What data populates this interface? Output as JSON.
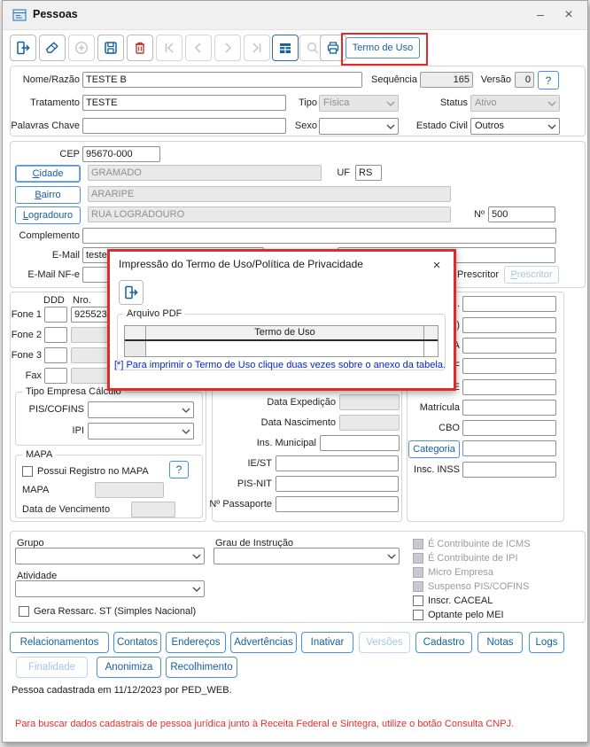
{
  "window": {
    "title": "Pessoas",
    "minimize_glyph": "–",
    "close_glyph": "×"
  },
  "toolbar": {
    "termo_de_uso_label": "Termo de Uso",
    "icons": [
      "exit-icon",
      "clear-icon",
      "add-icon",
      "save-icon",
      "delete-icon",
      "first-record-icon",
      "previous-record-icon",
      "next-record-icon",
      "last-record-icon",
      "browse-grid-icon",
      "search-icon",
      "print-icon"
    ]
  },
  "identity": {
    "nome_label": "Nome/Razão",
    "nome_value": "TESTE B",
    "sequencia_label": "Sequência",
    "sequencia_value": "165",
    "versao_label": "Versão",
    "versao_value": "0",
    "help_label": "?",
    "tratamento_label": "Tratamento",
    "tratamento_value": "TESTE",
    "tipo_label": "Tipo",
    "tipo_value": "Física",
    "status_label": "Status",
    "status_value": "Ativo",
    "palavras_chave_label": "Palavras Chave",
    "sexo_label": "Sexo",
    "sexo_value": "",
    "estado_civil_label": "Estado Civil",
    "estado_civil_value": "Outros"
  },
  "address": {
    "cep_label": "CEP",
    "cep_value": "95670-000",
    "cidade_button_label": "Cidade",
    "cidade_value": "GRAMADO",
    "uf_label": "UF",
    "uf_value": "RS",
    "bairro_button_label": "Bairro",
    "bairro_value": "ARARIPE",
    "logradouro_button_label": "Logradouro",
    "logradouro_value": "RUA LOGRADOURO",
    "numero_label": "Nº",
    "numero_value": "500",
    "complemento_label": "Complemento",
    "email_label": "E-Mail",
    "email_value": "teste",
    "email_nfe_label": "E-Mail NF-e"
  },
  "professional": {
    "prescritor_label": "Prescritor",
    "prescritor_button_label": "Prescritor",
    "hidden_label_fragments": [
      ".",
      ")",
      "A",
      "F",
      "E"
    ],
    "matricula_label": "Matrícula",
    "cbo_label": "CBO",
    "categoria_button_label": "Categoria",
    "insc_inss_label": "Insc. INSS"
  },
  "phones": {
    "ddd_header": "DDD",
    "nro_header": "Nro.",
    "fone1_label": "Fone 1",
    "fone1_value": "925523",
    "fone2_label": "Fone 2",
    "fone3_label": "Fone 3",
    "fax_label": "Fax"
  },
  "tax_group": {
    "title": "Tipo Empresa Cálculo",
    "pis_cofins_label": "PIS/COFINS",
    "ipi_label": "IPI"
  },
  "mapa_group": {
    "title": "MAPA",
    "possui_registro_label": "Possui Registro no MAPA",
    "help_label": "?",
    "mapa_label": "MAPA",
    "data_vencimento_label": "Data de Vencimento"
  },
  "documents": {
    "data_expedicao_label": "Data Expedição",
    "data_nascimento_label": "Data Nascimento",
    "ins_municipal_label": "Ins. Municipal",
    "ie_st_label": "IE/ST",
    "pis_nit_label": "PIS-NIT",
    "passaporte_label": "Nº Passaporte"
  },
  "classification": {
    "grupo_label": "Grupo",
    "grau_instrucao_label": "Grau de Instrução",
    "atividade_label": "Atividade",
    "gera_ressarc_label": "Gera Ressarc. ST (Simples Nacional)",
    "flags": [
      {
        "label": "É Contribuinte de ICMS",
        "enabled": false
      },
      {
        "label": "É Contribuinte de IPI",
        "enabled": false
      },
      {
        "label": "Micro Empresa",
        "enabled": false
      },
      {
        "label": "Suspenso PIS/COFINS",
        "enabled": false
      },
      {
        "label": "Inscr. CACEAL",
        "enabled": true
      },
      {
        "label": "Optante pelo MEI",
        "enabled": true
      }
    ]
  },
  "nav": {
    "row1": [
      {
        "label": "Relacionamentos",
        "enabled": true
      },
      {
        "label": "Contatos",
        "enabled": true
      },
      {
        "label": "Endereços",
        "enabled": true
      },
      {
        "label": "Advertências",
        "enabled": true
      },
      {
        "label": "Inativar",
        "enabled": true
      },
      {
        "label": "Versões",
        "enabled": false
      },
      {
        "label": "Cadastro",
        "enabled": true
      },
      {
        "label": "Notas",
        "enabled": true
      },
      {
        "label": "Logs",
        "enabled": true
      }
    ],
    "row2": [
      {
        "label": "Finalidade",
        "enabled": false
      },
      {
        "label": "Anonimiza",
        "enabled": true
      },
      {
        "label": "Recolhimento",
        "enabled": true
      }
    ]
  },
  "footer": {
    "status_text": "Pessoa cadastrada em 11/12/2023 por PED_WEB.",
    "warning_text": "Para buscar dados cadastrais de pessoa jurídica junto à Receita Federal e Sintegra, utilize o botão Consulta CNPJ."
  },
  "dialog": {
    "title": "Impressão do Termo de Uso/Política de Privacidade",
    "close_glyph": "×",
    "group_title": "Arquivo PDF",
    "table_header": "Termo de Uso",
    "footnote": "[*] Para imprimir o Termo de Uso clique duas vezes sobre o anexo da tabela."
  },
  "colors": {
    "accent_blue": "#15619e",
    "delete_red": "#c0392b",
    "annotation_red": "#e02b2b",
    "footnote_blue": "#0026d8",
    "warning_red": "#e03131"
  }
}
